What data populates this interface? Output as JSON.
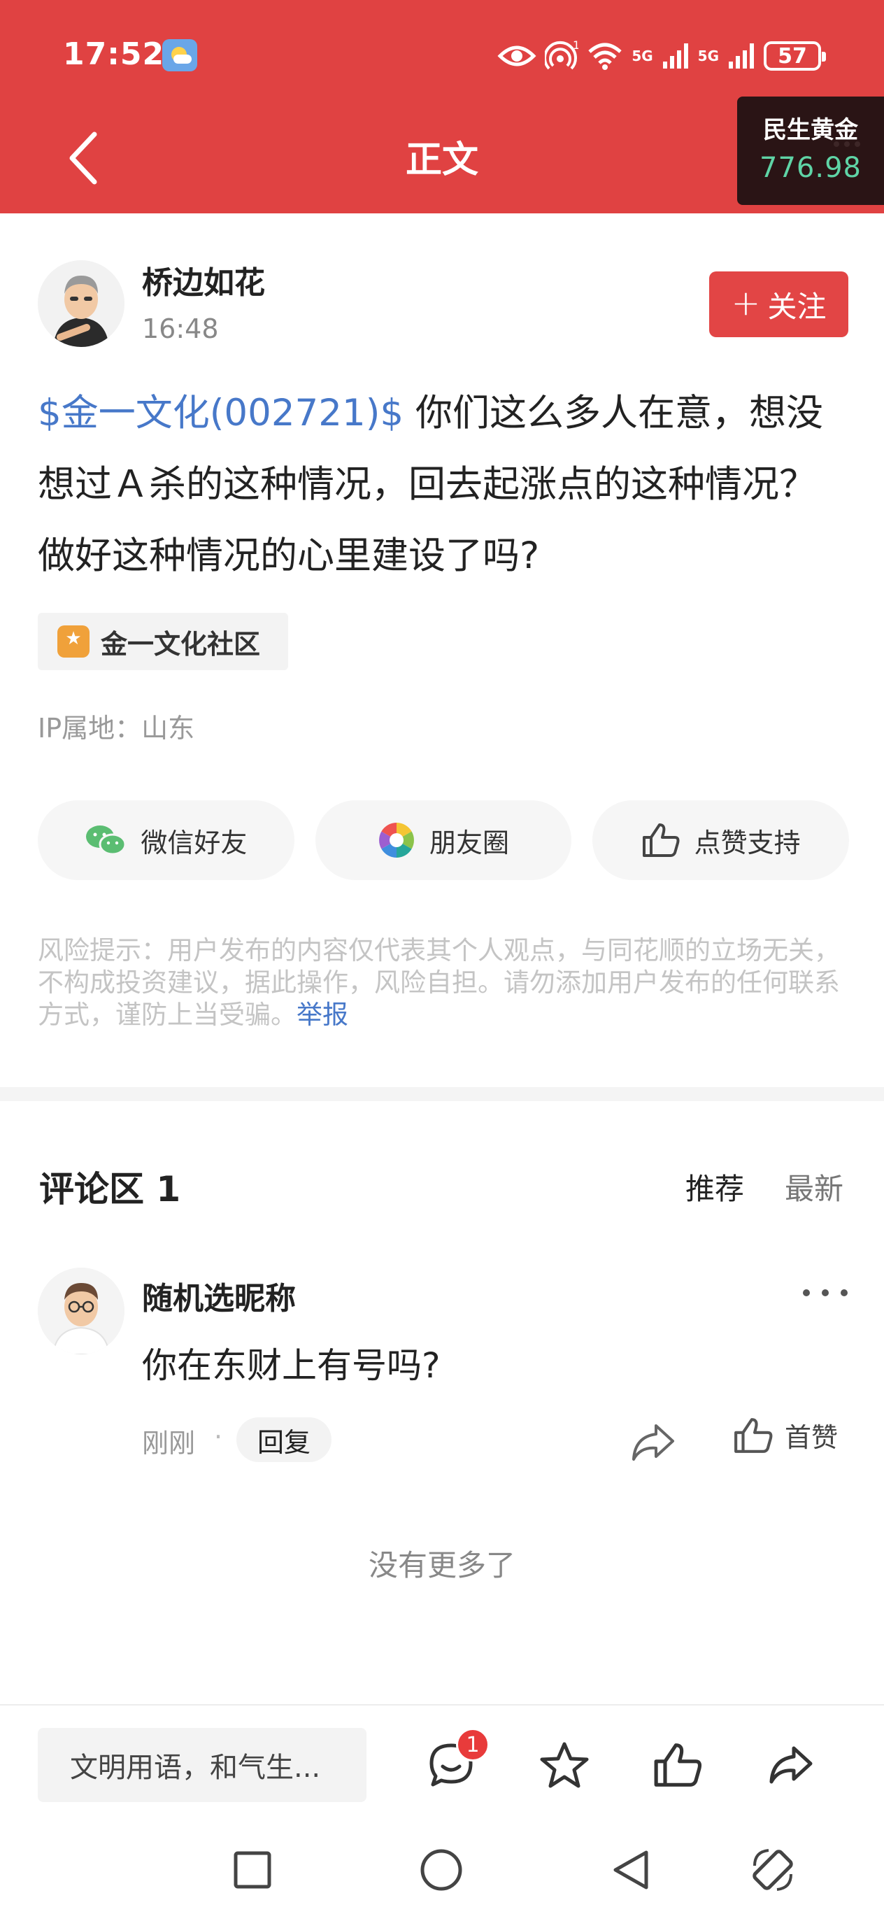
{
  "status_bar": {
    "time": "17:52",
    "net_badge": "1",
    "sim1": "5G",
    "sim2": "5G",
    "battery": "57"
  },
  "nav": {
    "title": "正文",
    "ticker": {
      "name": "民生黄金",
      "value": "776.98"
    }
  },
  "post": {
    "author": "桥边如花",
    "time": "16:48",
    "follow_label": "关注",
    "stock_tag": "$金一文化(002721)$",
    "text": " 你们这么多人在意，想没想过Ａ杀的这种情况，回去起涨点的这种情况？做好这种情况的心里建设了吗?",
    "community": "金一文化社区",
    "ip_location": "IP属地：山东"
  },
  "share": {
    "wechat": "微信好友",
    "moments": "朋友圈",
    "like_support": "点赞支持"
  },
  "risk": {
    "text": "风险提示：用户发布的内容仅代表其个人观点，与同花顺的立场无关，不构成投资建议，据此操作，风险自担。请勿添加用户发布的任何联系方式，谨防上当受骗。",
    "report": "举报"
  },
  "comments": {
    "title": "评论区 1",
    "sort_recommended": "推荐",
    "sort_latest": "最新",
    "items": [
      {
        "user": "随机选昵称",
        "text": "你在东财上有号吗?",
        "time": "刚刚",
        "dot": "·",
        "reply": "回复",
        "like_label": "首赞"
      }
    ],
    "no_more": "没有更多了"
  },
  "bottom": {
    "input_placeholder": "文明用语，和气生...",
    "comment_badge": "1"
  },
  "colors": {
    "brand_red": "#e04242",
    "link_blue": "#4778c9",
    "ticker_green": "#5fd4a6"
  },
  "icons": [
    "back-arrow-icon",
    "eye-icon",
    "hotspot-icon",
    "wifi-icon",
    "signal-icon",
    "battery-icon",
    "wechat-icon",
    "moments-icon",
    "thumb-up-icon",
    "share-icon",
    "comment-icon",
    "star-icon",
    "square-icon",
    "circle-icon",
    "triangle-back-icon",
    "rotate-icon"
  ]
}
